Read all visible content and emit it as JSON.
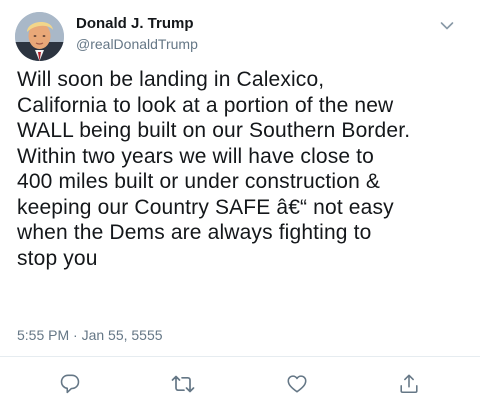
{
  "tweet": {
    "author": {
      "display_name": "Donald J. Trump",
      "handle": "@realDonaldTrump"
    },
    "text": "Will soon be landing in Calexico,\nCalifornia to look at a portion of the new\nWALL being built on our Southern Border.\nWithin two years we will have close to\n400 miles built or under construction &\nkeeping our Country SAFE â€“ not easy\nwhen the Dems are always fighting to\nstop you",
    "timestamp": "5:55 PM · Jan 55, 5555"
  },
  "actions": {
    "icons": [
      "reply-icon",
      "retweet-icon",
      "like-icon",
      "share-icon"
    ]
  },
  "colors": {
    "text": "#14171a",
    "secondary": "#657786",
    "divider": "#e6ecf0"
  }
}
